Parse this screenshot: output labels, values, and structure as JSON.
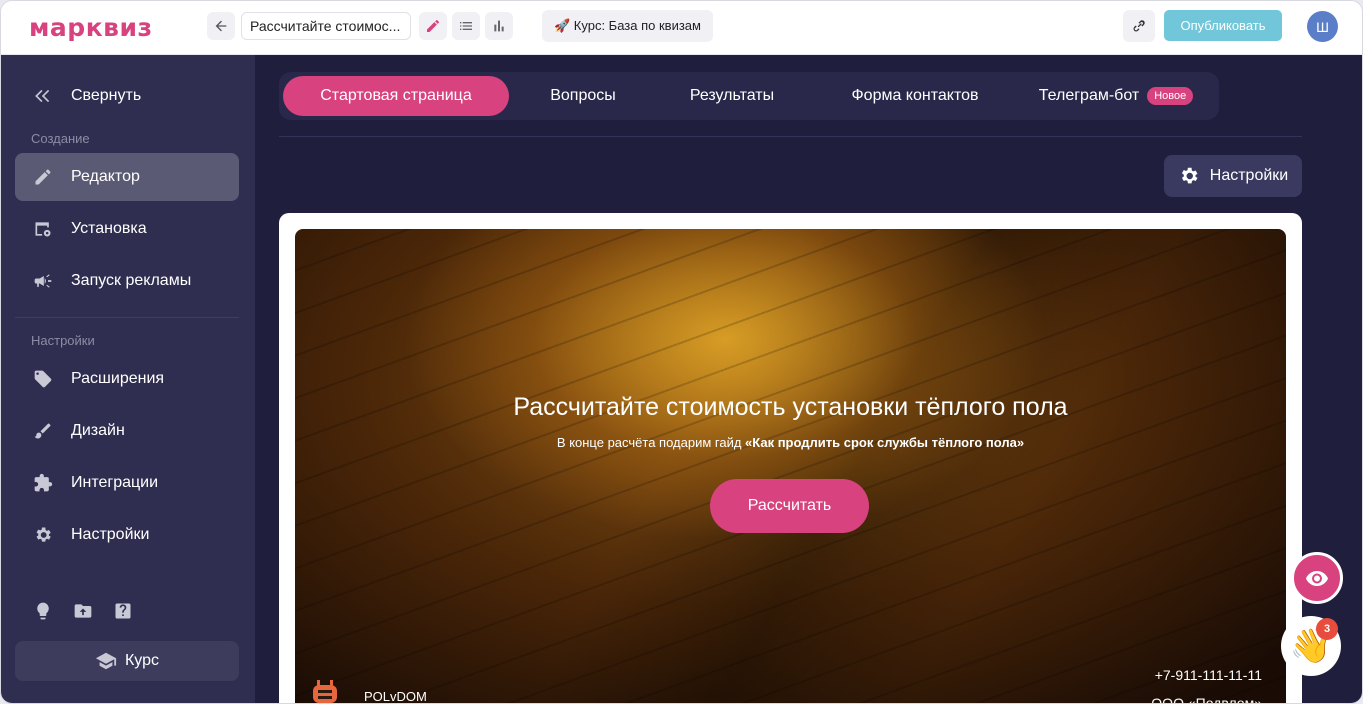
{
  "app": {
    "logo_text": "марквиз",
    "brand_color": "#d8437f",
    "accent_publish_color": "#71c7d9"
  },
  "toolbar": {
    "quiz_title": "Рассчитайте стоимос...",
    "course_label": "🚀 Курс: База по квизам",
    "publish_label": "Опубликовать",
    "avatar_letter": "Ш",
    "icons": [
      "back-arrow-icon",
      "pencil-icon",
      "list-icon",
      "bar-chart-icon",
      "link-icon"
    ]
  },
  "sidebar": {
    "collapse_label": "Свернуть",
    "section_create": "Создание",
    "section_settings": "Настройки",
    "items": [
      {
        "label": "Редактор",
        "icon": "pencil-icon",
        "active": true
      },
      {
        "label": "Установка",
        "icon": "install-icon"
      },
      {
        "label": "Запуск рекламы",
        "icon": "megaphone-icon"
      },
      {
        "label": "Расширения",
        "icon": "extensions-icon"
      },
      {
        "label": "Дизайн",
        "icon": "brush-icon"
      },
      {
        "label": "Интеграции",
        "icon": "integrations-icon"
      },
      {
        "label": "Настройки",
        "icon": "gear-icon"
      }
    ],
    "bottom_icons": [
      "lightbulb-icon",
      "folder-upload-icon",
      "help-icon"
    ],
    "course_label": "Курс"
  },
  "tabs": [
    {
      "label": "Стартовая страница",
      "active": true
    },
    {
      "label": "Вопросы"
    },
    {
      "label": "Результаты"
    },
    {
      "label": "Форма контактов"
    },
    {
      "label": "Телеграм-бот",
      "badge": "Новое"
    }
  ],
  "settings_button": "Настройки",
  "preview": {
    "title": "Рассчитайте стоимость установки тёплого пола",
    "subtitle_prefix": "В конце расчёта подарим гайд ",
    "subtitle_bold": "«Как продлить срок службы тёплого пола»",
    "cta_label": "Рассчитать",
    "company_name": "POLvDOM",
    "phone": "+7-911-111-11-11",
    "legal_name": "ООО «Подвлом»"
  },
  "fabs": {
    "preview_icon": "eye-icon",
    "wave_emoji": "👋",
    "notification_count": "3"
  }
}
